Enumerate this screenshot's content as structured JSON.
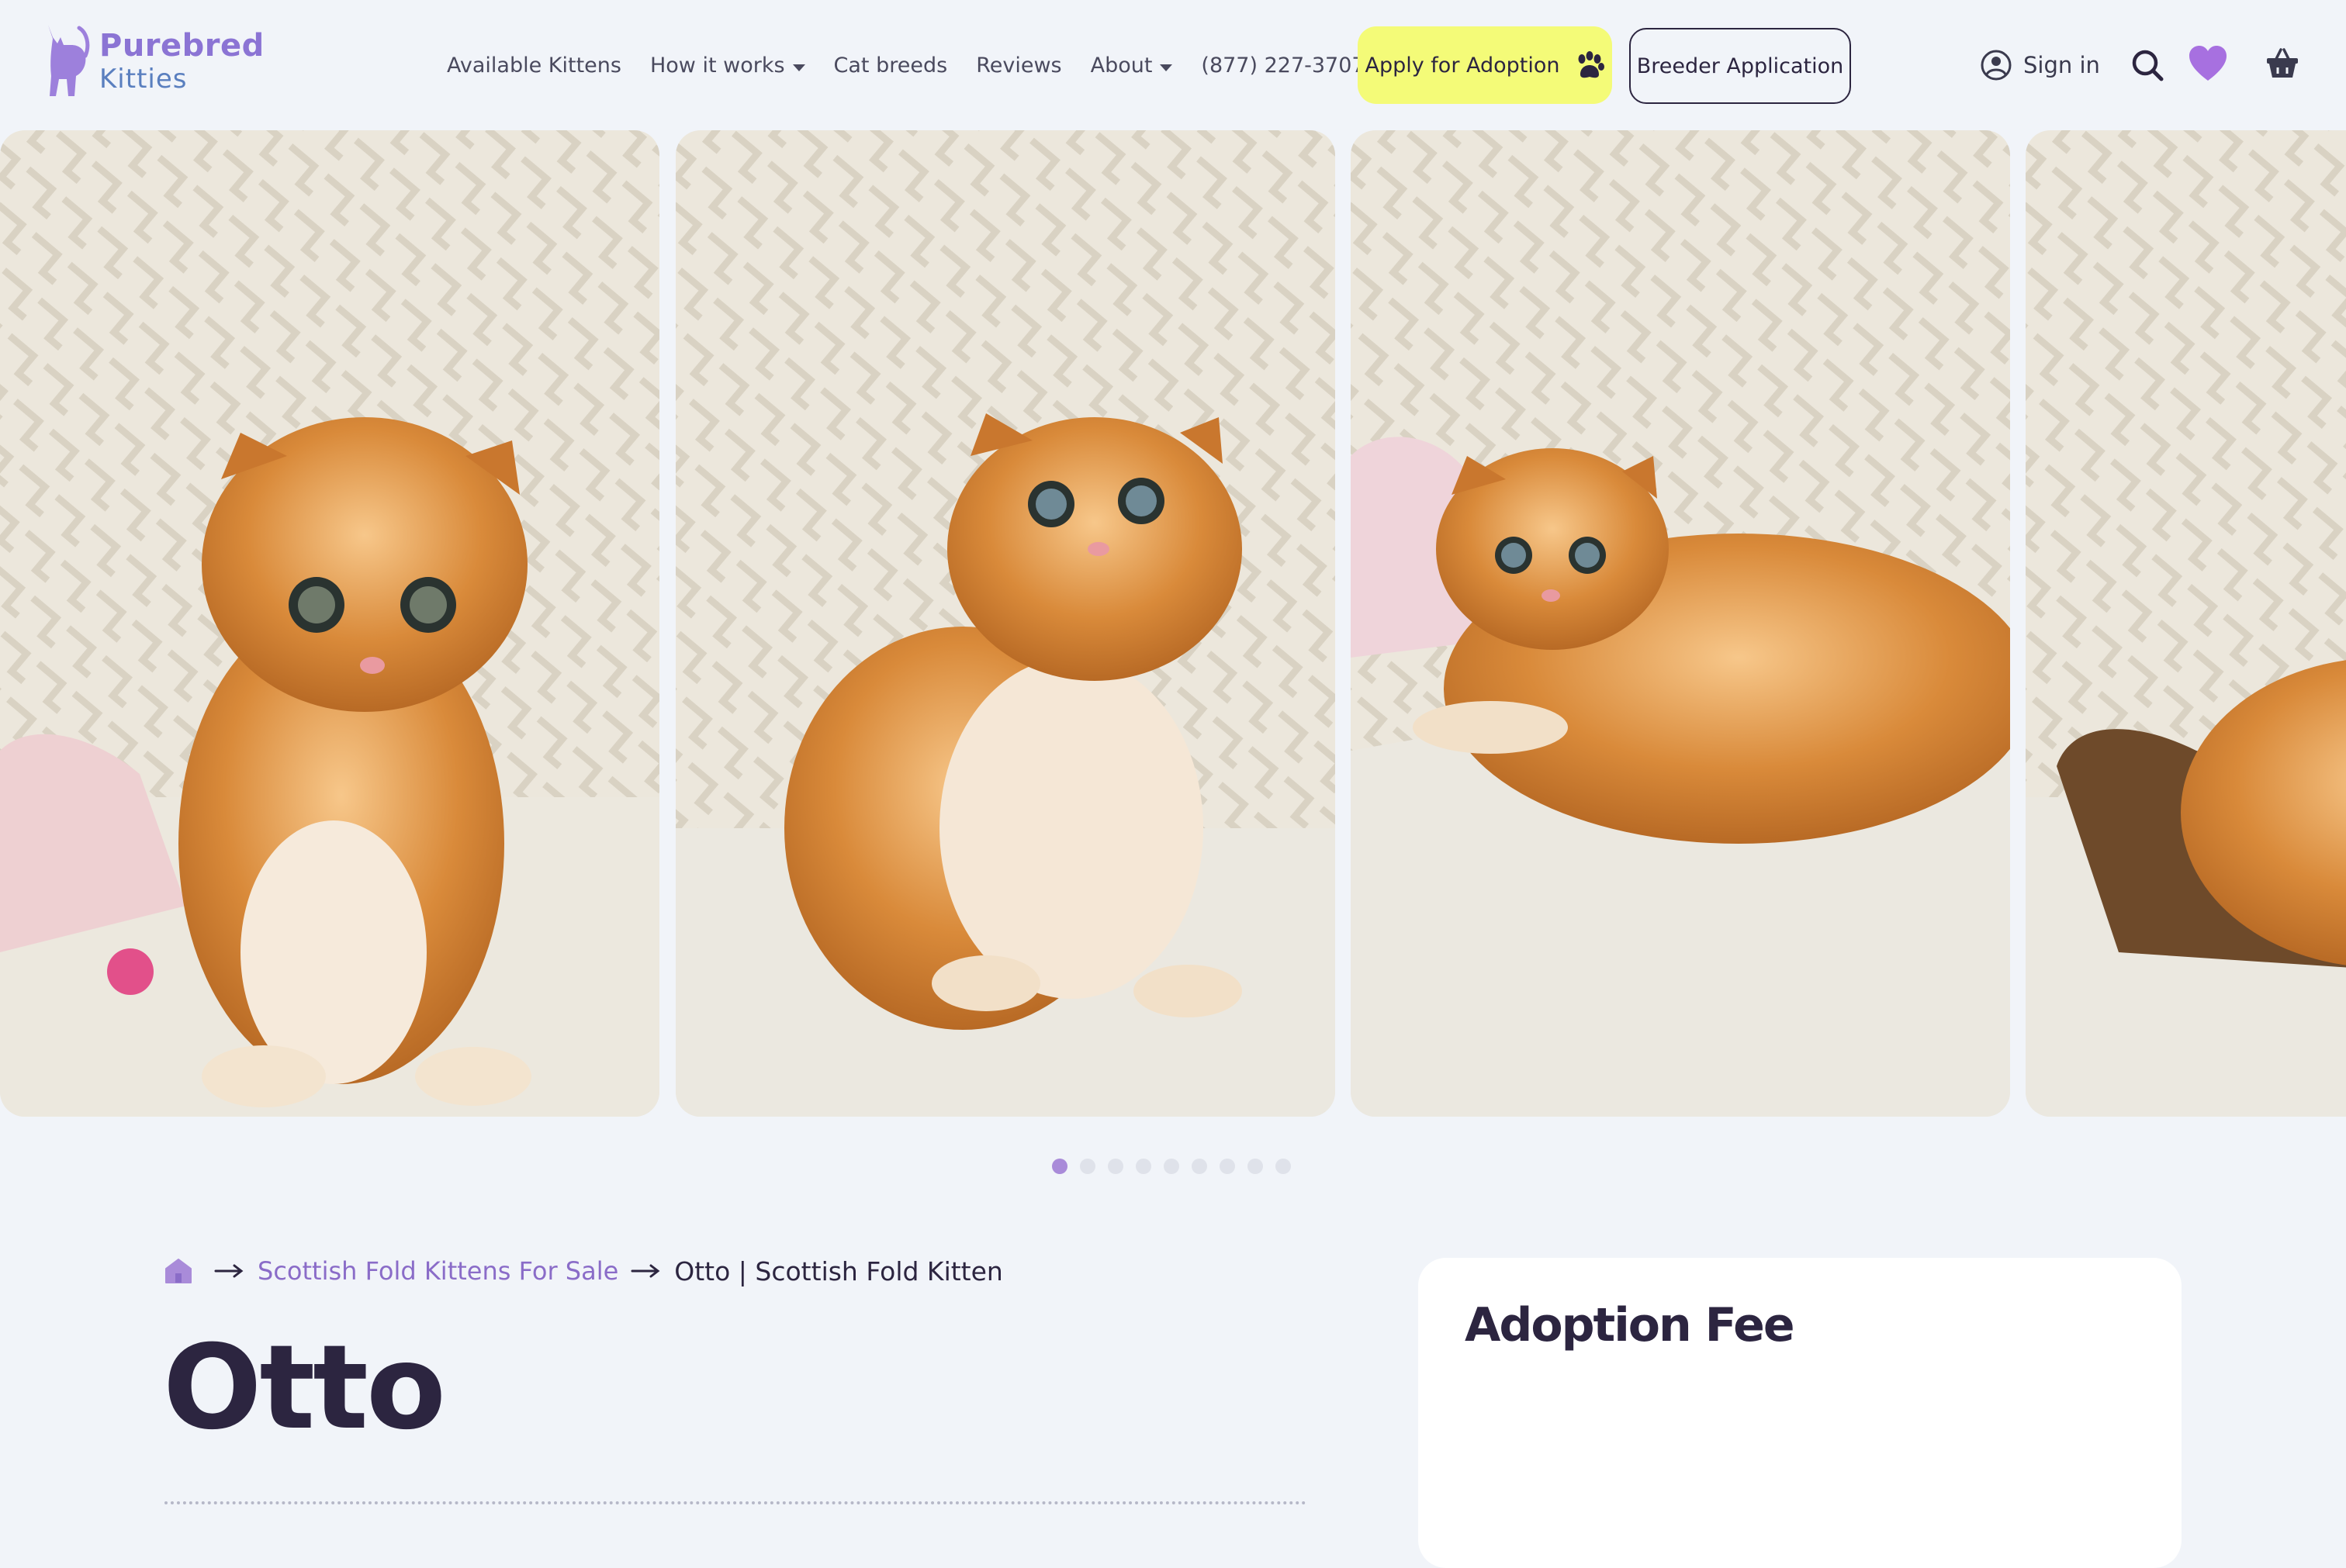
{
  "brand": {
    "line1": "Purebred",
    "line2": "Kitties"
  },
  "nav": {
    "items": [
      {
        "label": "Available Kittens",
        "dropdown": false
      },
      {
        "label": "How it works",
        "dropdown": true
      },
      {
        "label": "Cat breeds",
        "dropdown": false
      },
      {
        "label": "Reviews",
        "dropdown": false
      },
      {
        "label": "About",
        "dropdown": true
      },
      {
        "label": "(877) 227-3707",
        "dropdown": false
      }
    ],
    "apply_label": "Apply for Adoption",
    "breeder_label": "Breeder Application",
    "signin_label": "Sign in"
  },
  "icons": {
    "user": "user-circle-icon",
    "search": "search-icon",
    "favorites": "heart-icon",
    "cart": "basket-icon",
    "apply": "paw-icon"
  },
  "gallery": {
    "photos": [
      "kitten-photo-1",
      "kitten-photo-2",
      "kitten-photo-3",
      "kitten-photo-4"
    ],
    "slide_count": 9,
    "active_slide": 1
  },
  "breadcrumb": {
    "parent": "Scottish Fold Kittens For Sale",
    "current": "Otto | Scottish Fold Kitten"
  },
  "kitten": {
    "name": "Otto"
  },
  "fee_card": {
    "title": "Adoption Fee"
  },
  "colors": {
    "background": "#f1f4f9",
    "accent_purple": "#8b74d4",
    "apply_yellow": "#f4fb78",
    "text_dark": "#2c2540",
    "heart": "#a770e0"
  }
}
